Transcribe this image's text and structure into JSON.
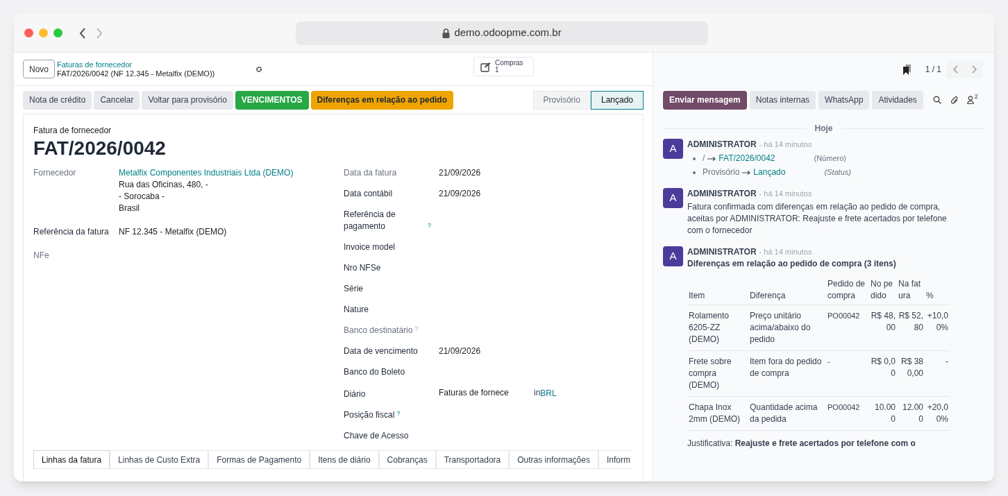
{
  "browser": {
    "url": "demo.odoopme.com.br"
  },
  "control_panel": {
    "new_button": "Novo",
    "breadcrumb": "Faturas de fornecedor",
    "record": "FAT/2026/0042 (NF 12.345 - Metalfix (DEMO))",
    "smart_button": {
      "label": "Compras",
      "count": "1"
    },
    "pager": "1 / 1"
  },
  "actions": [
    {
      "label": "Nota de crédito",
      "kind": "secondary"
    },
    {
      "label": "Cancelar",
      "kind": "secondary"
    },
    {
      "label": "Voltar para provisório",
      "kind": "secondary"
    },
    {
      "label": "VENCIMENTOS",
      "kind": "success"
    },
    {
      "label": "Diferenças em relação ao pedido",
      "kind": "warning"
    }
  ],
  "statusbar": [
    {
      "label": "Provisório",
      "selected": false
    },
    {
      "label": "Lançado",
      "selected": true
    }
  ],
  "chatter_buttons": [
    {
      "label": "Enviar mensagem",
      "kind": "primary"
    },
    {
      "label": "Notas internas",
      "kind": "secondary"
    },
    {
      "label": "WhatsApp",
      "kind": "secondary"
    },
    {
      "label": "Atividades",
      "kind": "secondary"
    }
  ],
  "followers_count": "2",
  "form": {
    "subtitle": "Fatura de fornecedor",
    "title": "FAT/2026/0042",
    "left_fields": [
      {
        "label": "Fornecedor",
        "muted": true,
        "link": "Metalfix Componentes Industriais Ltda (DEMO)",
        "lines": [
          "Rua das Oficinas, 480, -",
          "- Sorocaba -",
          "Brasil"
        ]
      },
      {
        "label": "Referência da fatura",
        "muted": false,
        "value": "NF 12.345 - Metalfix (DEMO)"
      },
      {
        "label": "NFe",
        "muted": true
      }
    ],
    "right_fields": [
      {
        "label": "Data da fatura",
        "muted": true,
        "value": "21/09/2026"
      },
      {
        "label": "Data contábil",
        "muted": false,
        "value": "21/09/2026"
      },
      {
        "label": "Referência de pagamento",
        "muted": false,
        "help": "?"
      },
      {
        "label": "Invoice model",
        "muted": false
      },
      {
        "label": "Nro NFSe",
        "muted": false
      },
      {
        "label": "Série",
        "muted": false
      },
      {
        "label": "Nature",
        "muted": false
      },
      {
        "label": "Banco destinatário",
        "muted": true,
        "help": "?"
      },
      {
        "label": "Data de vencimento",
        "muted": false,
        "value": "21/09/2026"
      },
      {
        "label": "Banco do Boleto",
        "muted": false
      },
      {
        "label": "Diário",
        "muted": false,
        "value": "Faturas de fornece",
        "joiner": "in",
        "currency": "BRL"
      },
      {
        "label": "Posição fiscal",
        "muted": false,
        "help": "?"
      },
      {
        "label": "Chave de Acesso",
        "muted": false
      }
    ],
    "tabs": [
      {
        "label": "Linhas da fatura",
        "selected": true
      },
      {
        "label": "Linhas de Custo Extra",
        "selected": false
      },
      {
        "label": "Formas de Pagamento",
        "selected": false
      },
      {
        "label": "Itens de diário",
        "selected": false
      },
      {
        "label": "Cobranças",
        "selected": false
      },
      {
        "label": "Transportadora",
        "selected": false
      },
      {
        "label": "Outras informações",
        "selected": false
      },
      {
        "label": "Inform",
        "selected": false
      }
    ]
  },
  "chatter": {
    "day": "Hoje",
    "messages": [
      {
        "kind": "tracking",
        "author": "ADMINISTRATOR",
        "avatar": "A",
        "time": "- há 14 minutos",
        "changes": [
          {
            "old": "/",
            "new": "FAT/2026/0042",
            "field": "(Número)"
          },
          {
            "old": "Provisório",
            "new": "Lançado",
            "field": "*(Status)*"
          }
        ]
      },
      {
        "kind": "text",
        "author": "ADMINISTRATOR",
        "avatar": "A",
        "time": "- há 14 minutos",
        "body": "Fatura confirmada com diferenças em relação ao pedido de compra, aceitas por ADMINISTRATOR: Reajuste e frete acertados por telefone com o fornecedor"
      },
      {
        "kind": "table",
        "author": "ADMINISTRATOR",
        "avatar": "A",
        "time": "- há 14 minutos",
        "heading": "Diferenças em relação ao pedido de compra (3 itens)",
        "columns": [
          "Item",
          "Diferença",
          "Pedido de compra",
          "No pedido",
          "Na fatura",
          "%"
        ],
        "rows": [
          [
            "Rolamento 6205-ZZ (DEMO)",
            "Preço unitário acima/abaixo do pedido",
            "PO00042",
            "R$ 48,00",
            "R$ 52,80",
            "+10,00%"
          ],
          [
            "Frete sobre compra (DEMO)",
            "Item fora do pedido de compra",
            "-",
            "R$ 0,00",
            "R$ 380,00",
            "-"
          ],
          [
            "Chapa Inox 2mm (DEMO)",
            "Quantidade acima da pedida",
            "PO00042",
            "10.000",
            "12.000",
            "+20,00%"
          ]
        ],
        "note": "Justificativa: **Reajuste e frete acertados por telefone com o**"
      }
    ]
  }
}
